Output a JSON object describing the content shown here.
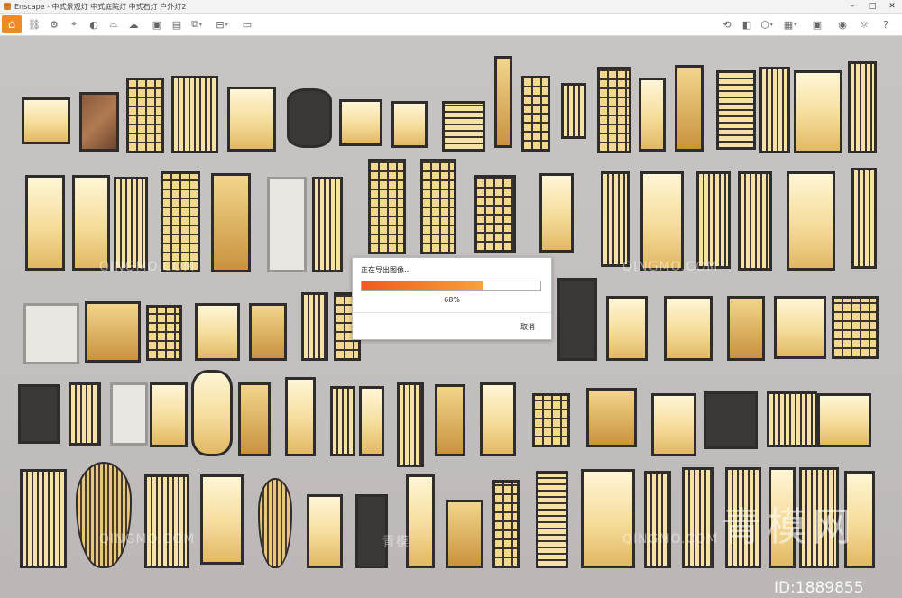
{
  "window": {
    "title": "Enscape - 中式景观灯 中式庭院灯 中式石灯 户外灯2",
    "controls": [
      "–",
      "□",
      "✕"
    ]
  },
  "toolbar": {
    "tools": [
      "home-icon",
      "link-icon",
      "settings-icon",
      "pin-icon",
      "camera-icon",
      "hat-icon",
      "cloud-icon",
      "image-export-icon",
      "render-icon",
      "layers-icon",
      "panorama-icon",
      "monitor-icon",
      "sync-icon",
      "cube-icon",
      "box-icon",
      "grid-icon",
      "eye-icon",
      "sun-icon",
      "help-icon"
    ]
  },
  "dialog": {
    "title": "正在导出图像...",
    "progress": 0.68,
    "percent_text": "68%",
    "cancel": "取消"
  },
  "watermarks": {
    "tile_text": "QINGMO.COM",
    "tile_text_cn": "青模",
    "brand": "青模网",
    "id": "ID:1889855"
  },
  "colors": {
    "accent": "#f08a24",
    "progress_start": "#f05a1e",
    "progress_end": "#f7a23a",
    "viewport_bg": "#c6c2c2"
  }
}
